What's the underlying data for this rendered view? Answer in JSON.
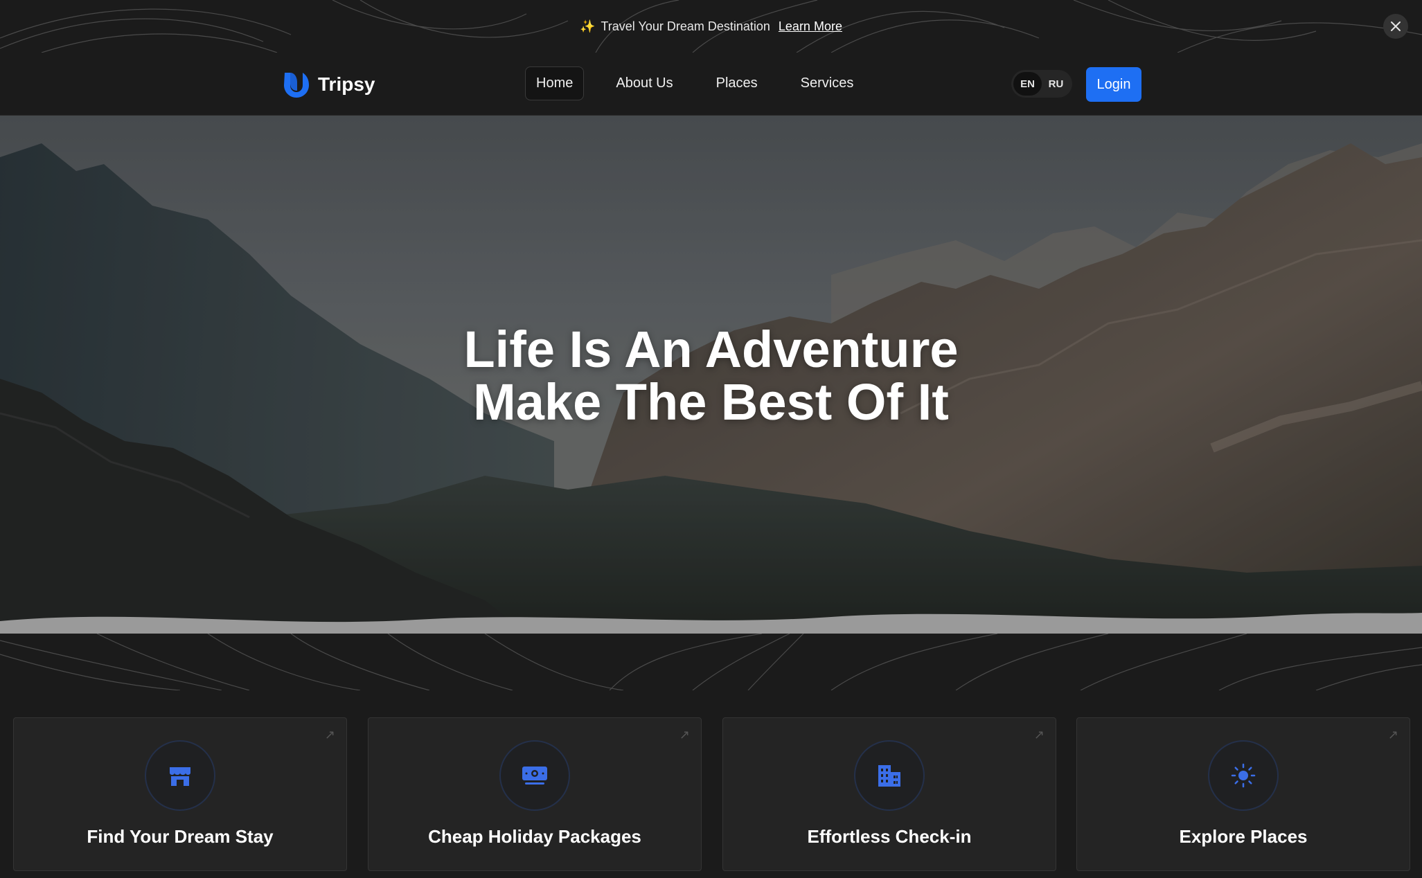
{
  "announcement": {
    "text": "Travel Your Dream Destination",
    "link": "Learn More"
  },
  "header": {
    "brand": "Tripsy",
    "nav": [
      "Home",
      "About Us",
      "Places",
      "Services"
    ],
    "active_nav": "Home",
    "languages": [
      "EN",
      "RU"
    ],
    "active_language": "EN",
    "login_label": "Login"
  },
  "hero": {
    "line1": "Life Is An Adventure",
    "line2": "Make The Best Of It"
  },
  "features": [
    {
      "title": "Find Your Dream Stay",
      "icon": "storefront-icon"
    },
    {
      "title": "Cheap Holiday Packages",
      "icon": "money-icon"
    },
    {
      "title": "Effortless Check-in",
      "icon": "building-icon"
    },
    {
      "title": "Explore Places",
      "icon": "sun-icon"
    }
  ],
  "colors": {
    "accent": "#1e6ff3",
    "icon_accent": "#3b6ee8",
    "background": "#1b1b1b",
    "card": "#242424"
  }
}
